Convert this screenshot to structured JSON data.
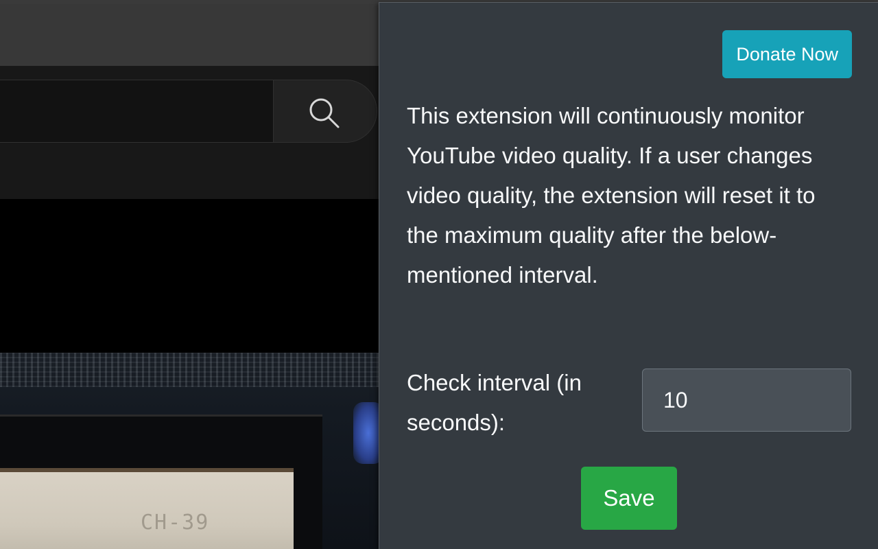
{
  "popup": {
    "donate_label": "Donate Now",
    "description": "This extension will continuously monitor YouTube video quality. If a user changes video quality, the extension will reset it to the maximum quality after the below-mentioned interval.",
    "interval_label": "Check interval (in seconds):",
    "interval_value": "10",
    "save_label": "Save"
  },
  "background": {
    "video_screen_text": "CH-39"
  },
  "colors": {
    "popup_bg": "#343a40",
    "donate": "#17a2b8",
    "save": "#28a745",
    "input_bg": "#495057"
  }
}
